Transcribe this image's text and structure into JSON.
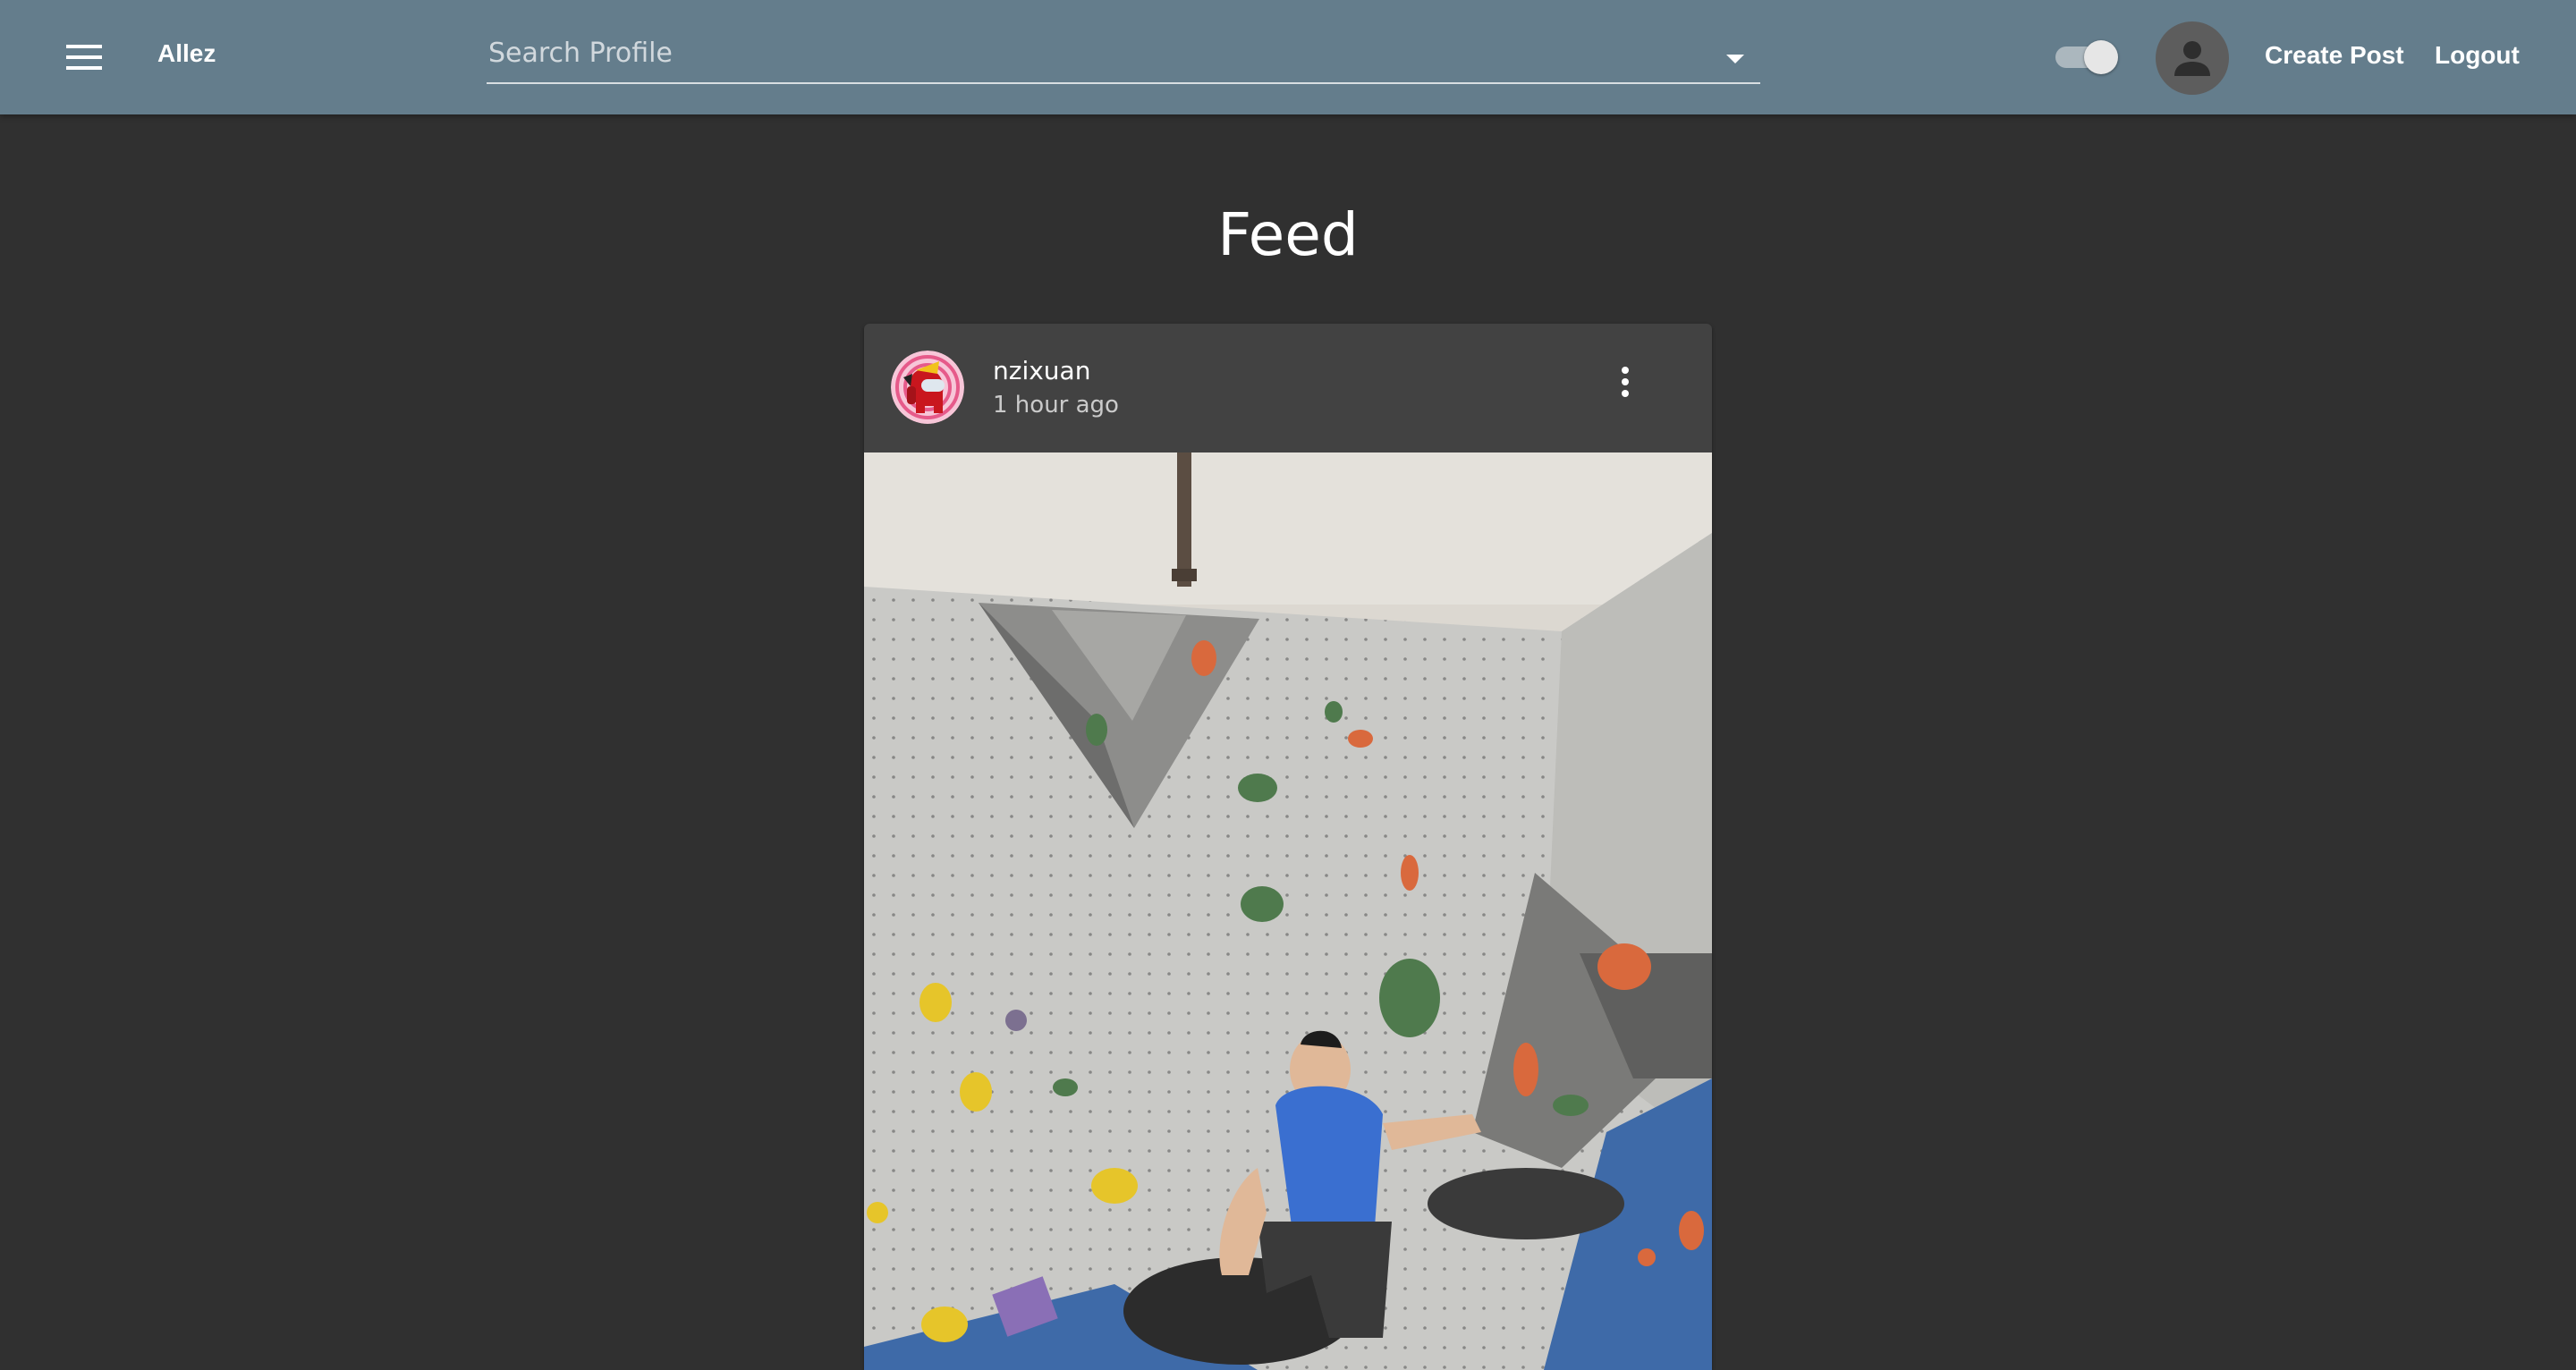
{
  "appbar": {
    "title": "Allez",
    "search_placeholder": "Search Profile",
    "create_post": "Create Post",
    "logout": "Logout",
    "theme_toggle_on": true,
    "color": "#647d8c"
  },
  "page": {
    "title": "Feed",
    "background": "#303030"
  },
  "post": {
    "username": "nzixuan",
    "time": "1 hour ago",
    "media": "indoor bouldering wall photo"
  },
  "icons": {
    "menu": "menu-icon",
    "dropdown": "arrow-drop-down-icon",
    "account": "account-circle-icon",
    "more": "more-vert-icon"
  }
}
